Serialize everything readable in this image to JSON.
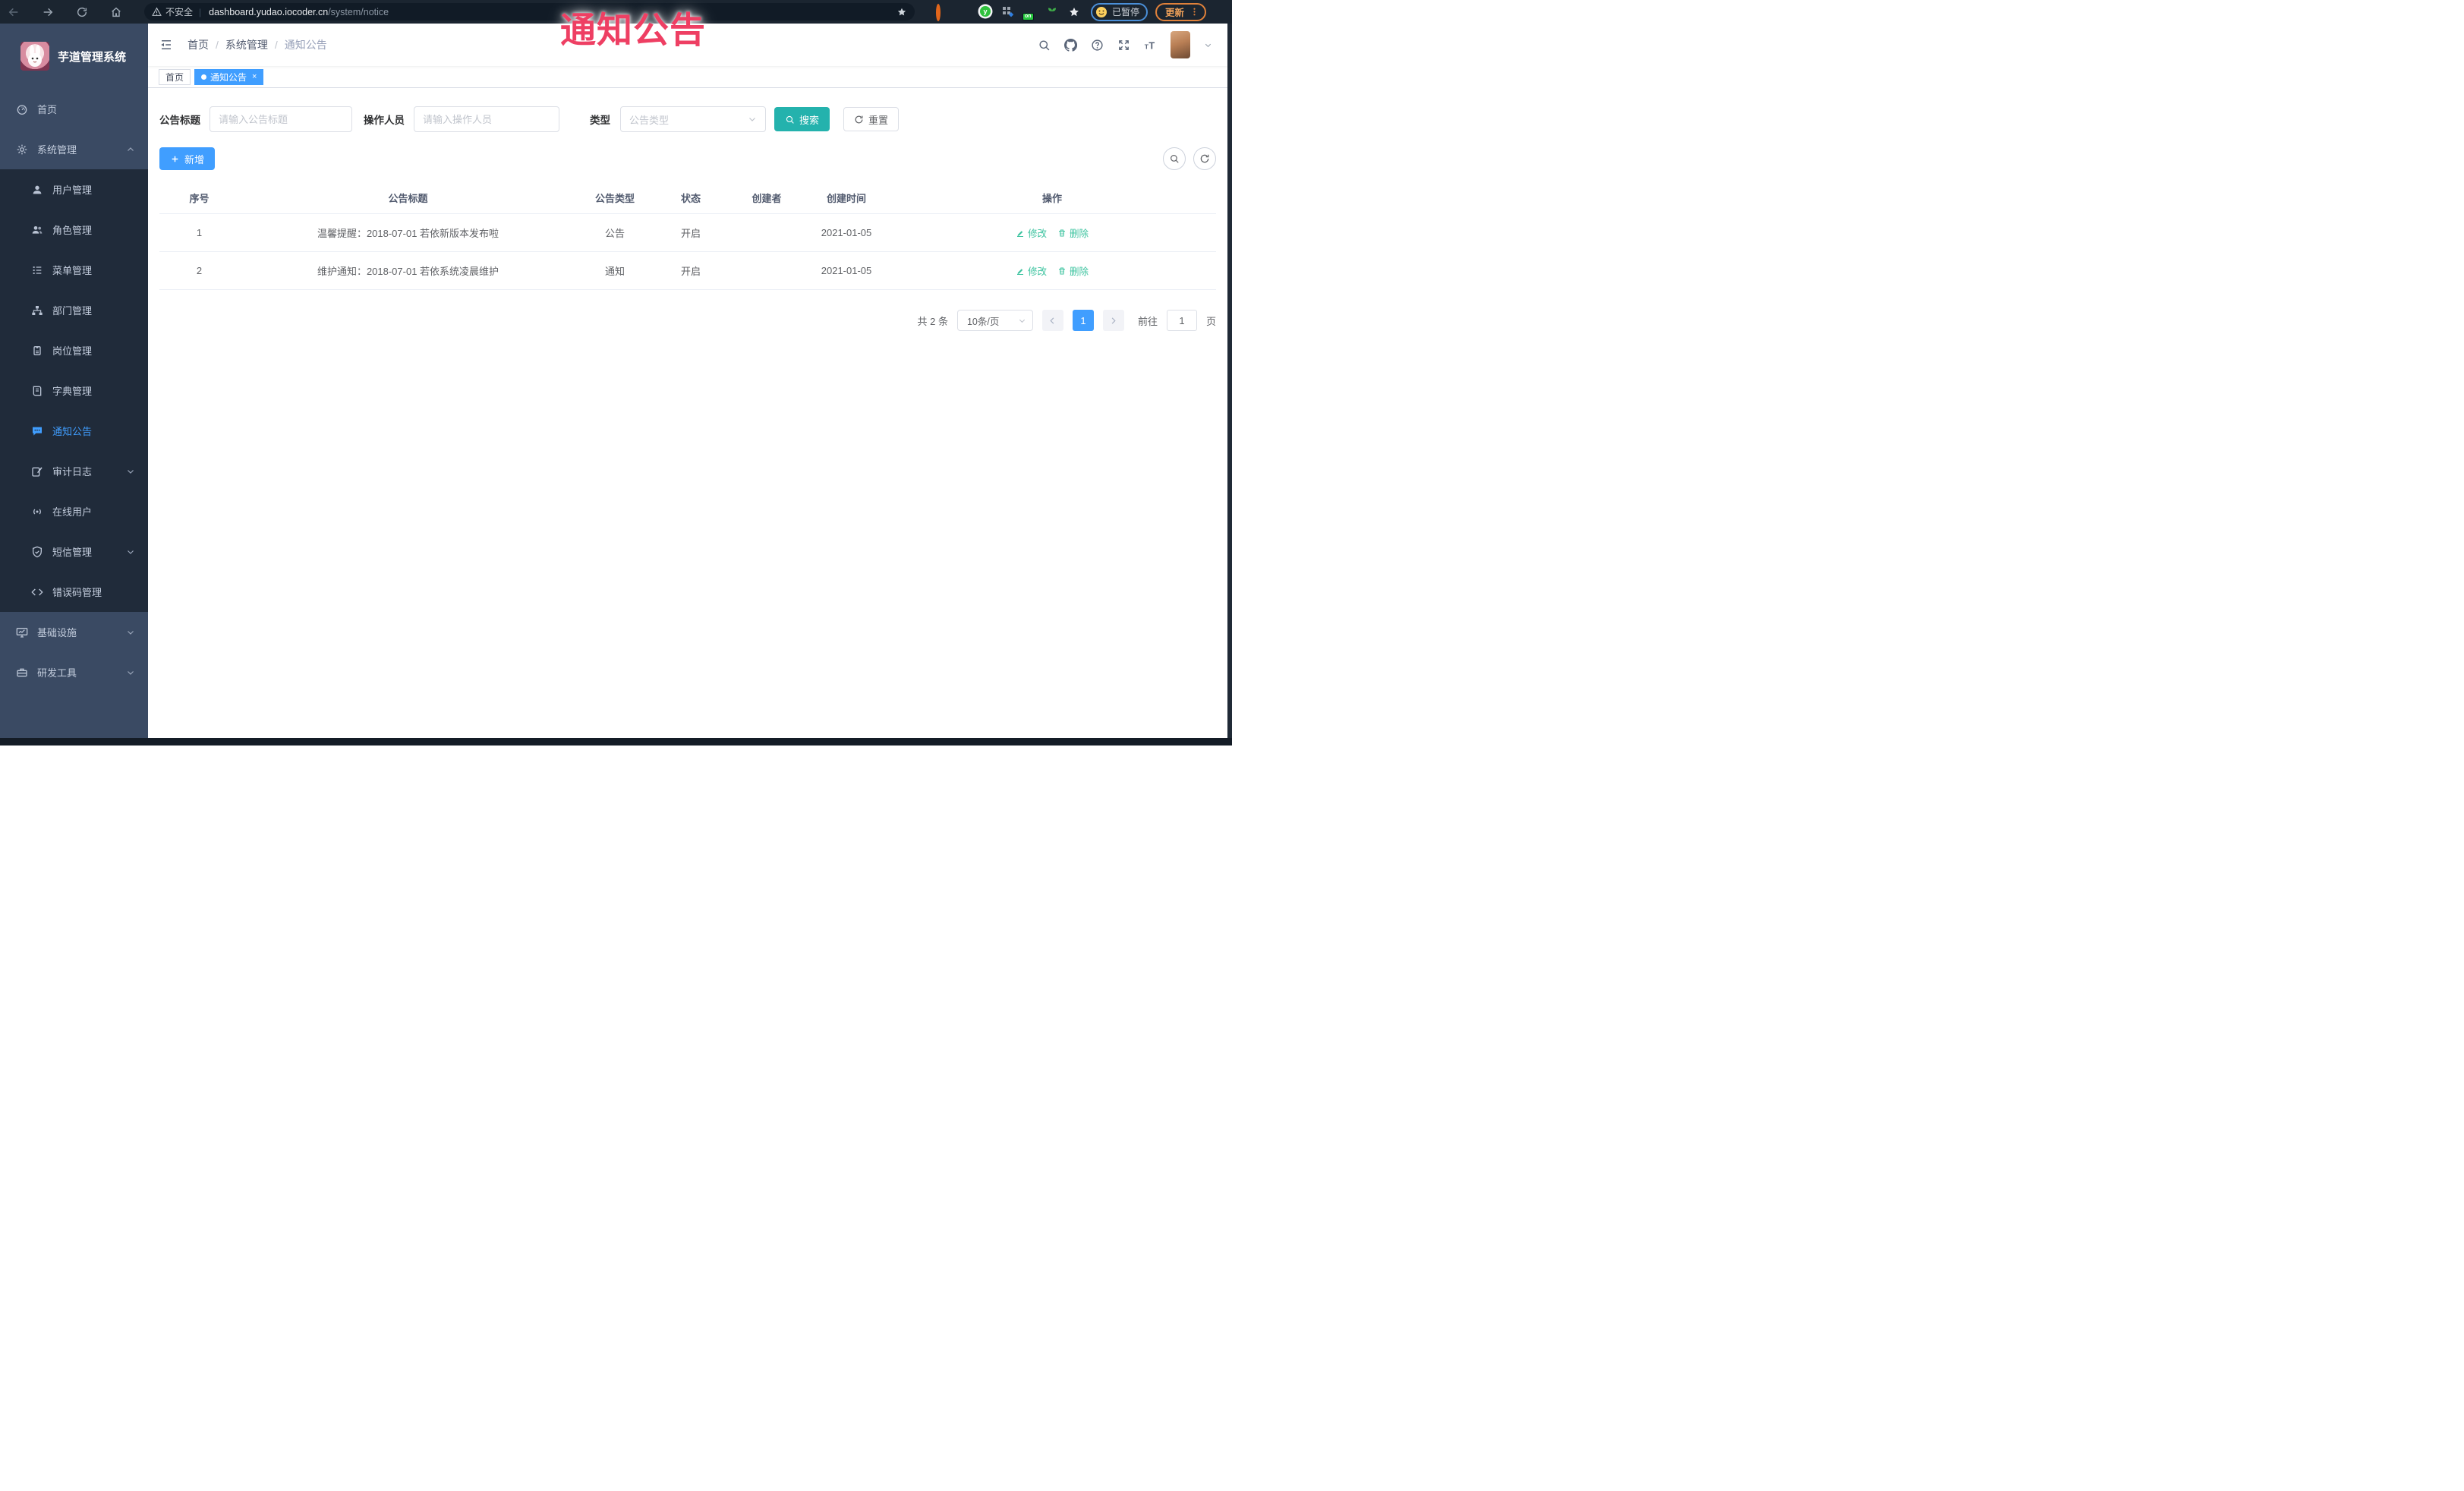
{
  "annotation": {
    "text": "通知公告"
  },
  "browser": {
    "security_label": "不安全",
    "url_domain": "dashboard.yudao.iocoder.cn",
    "url_path": "/system/notice",
    "extension_badge": "on",
    "extension_letter": "y",
    "profile_status": "已暂停",
    "update_label": "更新"
  },
  "sidebar": {
    "title": "芋道管理系统",
    "menu": [
      {
        "label": "首页",
        "icon": "dashboard",
        "level": 1
      },
      {
        "label": "系统管理",
        "icon": "gear",
        "level": 1,
        "arrow": "up",
        "expanded": true
      },
      {
        "label": "用户管理",
        "icon": "user",
        "level": 2
      },
      {
        "label": "角色管理",
        "icon": "users",
        "level": 2
      },
      {
        "label": "菜单管理",
        "icon": "menu-list",
        "level": 2
      },
      {
        "label": "部门管理",
        "icon": "org-tree",
        "level": 2
      },
      {
        "label": "岗位管理",
        "icon": "id-badge",
        "level": 2
      },
      {
        "label": "字典管理",
        "icon": "book",
        "level": 2
      },
      {
        "label": "通知公告",
        "icon": "message",
        "level": 2,
        "active": true
      },
      {
        "label": "审计日志",
        "icon": "audit-log",
        "level": 2,
        "arrow": "down"
      },
      {
        "label": "在线用户",
        "icon": "online-user",
        "level": 2
      },
      {
        "label": "短信管理",
        "icon": "shield-check",
        "level": 2,
        "arrow": "down"
      },
      {
        "label": "错误码管理",
        "icon": "code",
        "level": 2
      },
      {
        "label": "基础设施",
        "icon": "monitor-chart",
        "level": 1,
        "arrow": "down"
      },
      {
        "label": "研发工具",
        "icon": "toolbox",
        "level": 1,
        "arrow": "down"
      }
    ]
  },
  "header": {
    "breadcrumb": [
      "首页",
      "系统管理",
      "通知公告"
    ]
  },
  "tabs": [
    {
      "label": "首页",
      "active": false
    },
    {
      "label": "通知公告",
      "active": true,
      "closable": true,
      "close_glyph": "×"
    }
  ],
  "filters": {
    "title_label": "公告标题",
    "title_placeholder": "请输入公告标题",
    "operator_label": "操作人员",
    "operator_placeholder": "请输入操作人员",
    "type_label": "类型",
    "type_placeholder": "公告类型",
    "search_label": "搜索",
    "reset_label": "重置"
  },
  "toolbar": {
    "add_label": "新增"
  },
  "table": {
    "columns": [
      "序号",
      "公告标题",
      "公告类型",
      "状态",
      "创建者",
      "创建时间",
      "操作"
    ],
    "rows": [
      {
        "index": "1",
        "title": "温馨提醒：2018-07-01 若依新版本发布啦",
        "type": "公告",
        "status": "开启",
        "creator": "",
        "created": "2021-01-05",
        "edit_label": "修改",
        "delete_label": "删除"
      },
      {
        "index": "2",
        "title": "维护通知：2018-07-01 若依系统凌晨维护",
        "type": "通知",
        "status": "开启",
        "creator": "",
        "created": "2021-01-05",
        "edit_label": "修改",
        "delete_label": "删除"
      }
    ]
  },
  "pagination": {
    "total": "共 2 条",
    "page_size": "10条/页",
    "current_page": "1",
    "goto_label": "前往",
    "goto_value": "1",
    "page_unit": "页"
  },
  "colors": {
    "accent_blue": "#409eff",
    "search_teal": "#24b2ad",
    "action_link_green": "#3cc39f",
    "annotation_pink": "#ee3f63",
    "sidebar_bg": "#3a4a63",
    "submenu_bg": "#202b3a"
  }
}
